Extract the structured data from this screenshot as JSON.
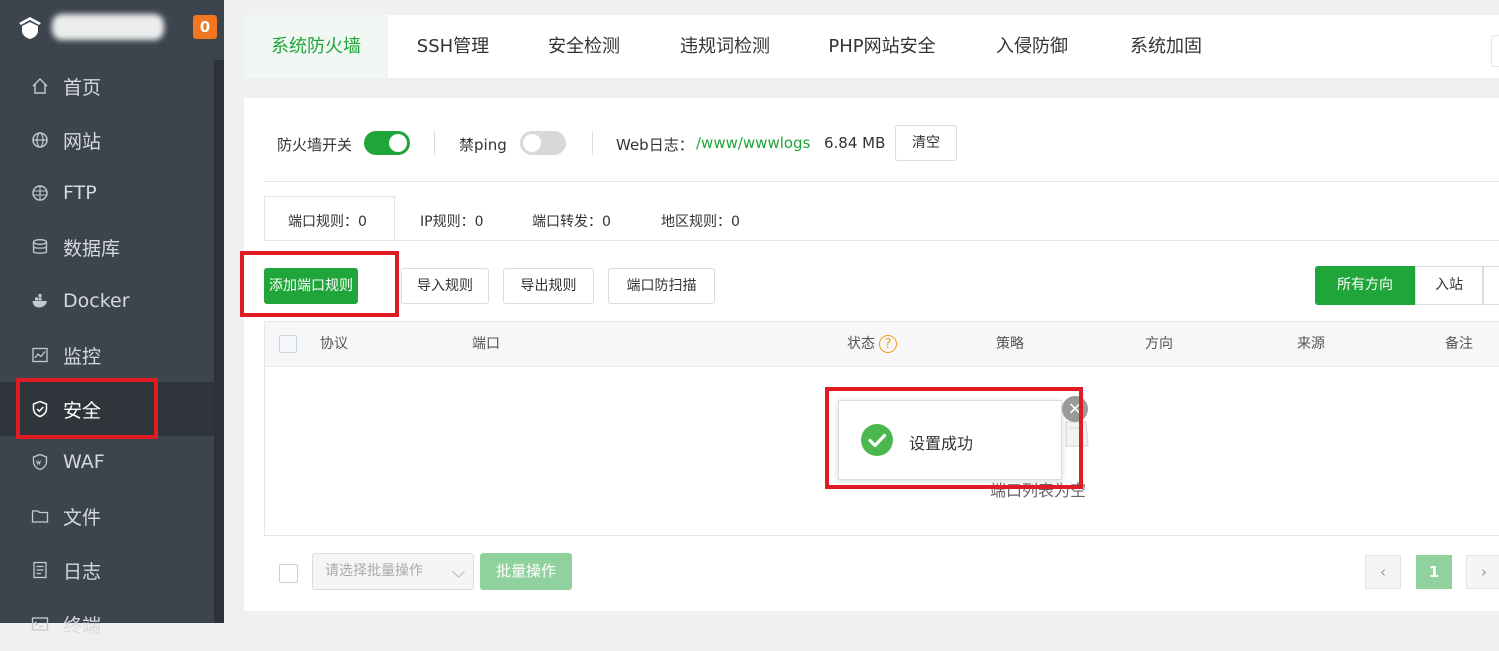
{
  "sidebar": {
    "message_count": "0",
    "items": [
      {
        "label": "首页",
        "icon": "home-icon"
      },
      {
        "label": "网站",
        "icon": "globe-icon"
      },
      {
        "label": "FTP",
        "icon": "ftp-globe-icon"
      },
      {
        "label": "数据库",
        "icon": "database-icon"
      },
      {
        "label": "Docker",
        "icon": "docker-icon"
      },
      {
        "label": "监控",
        "icon": "monitor-chart-icon"
      },
      {
        "label": "安全",
        "icon": "shield-icon"
      },
      {
        "label": "WAF",
        "icon": "waf-shield-icon"
      },
      {
        "label": "文件",
        "icon": "folder-icon"
      },
      {
        "label": "日志",
        "icon": "log-icon"
      },
      {
        "label": "终端",
        "icon": "terminal-icon"
      }
    ]
  },
  "top_tabs": [
    "系统防火墙",
    "SSH管理",
    "安全检测",
    "违规词检测",
    "PHP网站安全",
    "入侵防御",
    "系统加固"
  ],
  "settings": {
    "firewall_switch_label": "防火墙开关",
    "ping_label": "禁ping",
    "web_log_label": "Web日志：",
    "web_log_path": "/www/wwwlogs",
    "web_log_size": "6.84 MB",
    "clear_button": "清空"
  },
  "sub_tabs": [
    "端口规则：0",
    "IP规则：0",
    "端口转发：0",
    "地区规则：0"
  ],
  "toolbar": {
    "add_port_rule": "添加端口规则",
    "import_rules": "导入规则",
    "export_rules": "导出规则",
    "port_scan_protect": "端口防扫描",
    "direction_all": "所有方向",
    "direction_in": "入站"
  },
  "table": {
    "headers": [
      "协议",
      "端口",
      "状态",
      "策略",
      "方向",
      "来源",
      "备注"
    ],
    "empty_text": "端口列表为空"
  },
  "footer": {
    "batch_placeholder": "请选择批量操作",
    "batch_button": "批量操作",
    "page_prev": "‹",
    "page_current": "1",
    "page_next": "›"
  },
  "toast": {
    "message": "设置成功",
    "close": "×"
  },
  "colors": {
    "accent": "#20a53a",
    "sidebar_bg": "#3c444d",
    "highlight": "#e01b24",
    "badge": "#f0771f"
  }
}
